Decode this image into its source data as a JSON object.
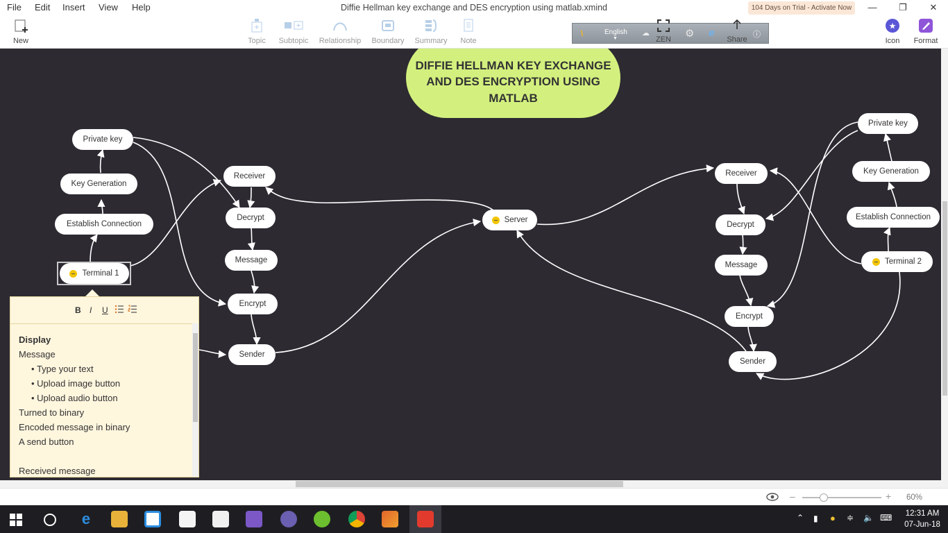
{
  "menu": [
    "File",
    "Edit",
    "Insert",
    "View",
    "Help"
  ],
  "window": {
    "title": "Diffie Hellman key exchange and DES encryption using matlab.xmind",
    "trial": "104 Days on Trial - Activate Now",
    "controls": [
      "minimize-icon",
      "restore-icon",
      "close-icon"
    ]
  },
  "toolbar": {
    "new": "New",
    "topic": "Topic",
    "subtopic": "Subtopic",
    "relationship": "Relationship",
    "boundary": "Boundary",
    "summary": "Summary",
    "note": "Note",
    "ime_language": "English",
    "zen": "ZEN",
    "share": "Share",
    "icon": "Icon",
    "format": "Format"
  },
  "map": {
    "central": "DIFFIE HELLMAN KEY EXCHANGE AND DES ENCRYPTION USING MATLAB",
    "server": "Server",
    "left": {
      "private_key": "Private key",
      "key_generation": "Key Generation",
      "establish_connection": "Establish Connection",
      "terminal": "Terminal 1",
      "receiver": "Receiver",
      "decrypt": "Decrypt",
      "message": "Message",
      "encrypt": "Encrypt",
      "sender": "Sender"
    },
    "right": {
      "private_key": "Private key",
      "key_generation": "Key Generation",
      "establish_connection": "Establish Connection",
      "terminal": "Terminal 2",
      "receiver": "Receiver",
      "decrypt": "Decrypt",
      "message": "Message",
      "encrypt": "Encrypt",
      "sender": "Sender"
    }
  },
  "notes": {
    "format_buttons": [
      "B",
      "I",
      "U"
    ],
    "lines": {
      "heading": "Display",
      "l1": "Message",
      "b1": "Type your text",
      "b2": "Upload image button",
      "b3": "Upload audio button",
      "l2": "Turned to binary",
      "l3": "Encoded message in binary",
      "l4": "A send button",
      "l5": "Received message"
    }
  },
  "status": {
    "zoom": "60%"
  },
  "taskbar": {
    "time": "12:31 AM",
    "date": "07-Jun-18"
  }
}
